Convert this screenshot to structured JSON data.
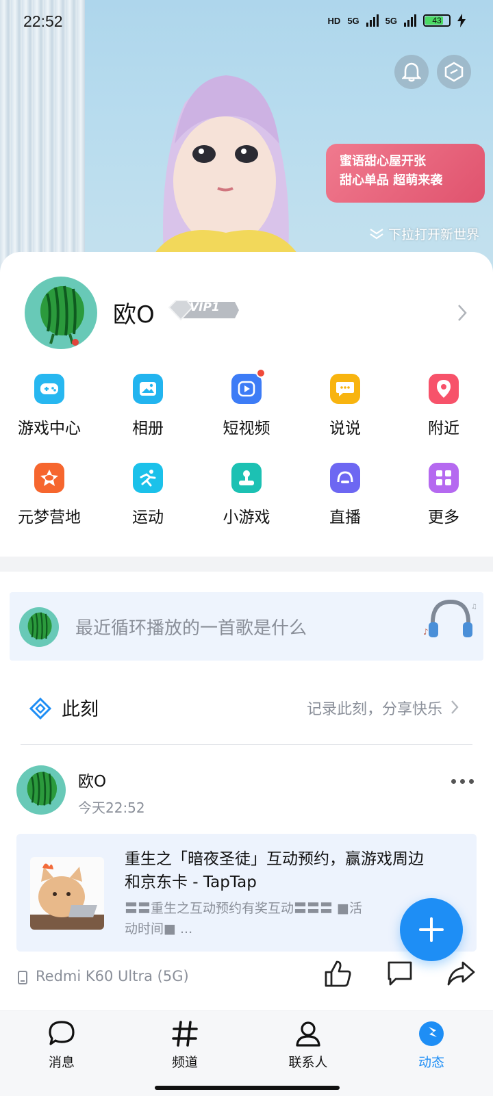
{
  "status_bar": {
    "time": "22:52",
    "hd_label": "HD",
    "network1": "5G",
    "network2": "5G",
    "battery_level": "43"
  },
  "banner": {
    "promo_line1": "蜜语甜心屋开张",
    "promo_line2": "甜心单品 超萌来袭",
    "pull_hint": "下拉打开新世界"
  },
  "profile": {
    "nickname": "欧O",
    "vip_label": "VIP1"
  },
  "grid": {
    "row1": [
      {
        "label": "游戏中心",
        "icon": "gamepad-icon",
        "color": "#27b7f0"
      },
      {
        "label": "相册",
        "icon": "photo-album-icon",
        "color": "#22b4ef"
      },
      {
        "label": "短视频",
        "icon": "short-video-icon",
        "color": "#3d7cf6",
        "badge": true
      },
      {
        "label": "说说",
        "icon": "chat-bubble-icon",
        "color": "#f8b40f"
      },
      {
        "label": "附近",
        "icon": "location-pin-icon",
        "color": "#f7526a"
      }
    ],
    "row2": [
      {
        "label": "元梦营地",
        "icon": "camp-icon",
        "color": "#f6662e"
      },
      {
        "label": "运动",
        "icon": "running-icon",
        "color": "#1bc1ea"
      },
      {
        "label": "小游戏",
        "icon": "joystick-icon",
        "color": "#1cc1b3"
      },
      {
        "label": "直播",
        "icon": "live-icon",
        "color": "#6d67f2"
      },
      {
        "label": "更多",
        "icon": "more-grid-icon",
        "color": "#b569f0"
      }
    ]
  },
  "prompt": {
    "text": "最近循环播放的一首歌是什么"
  },
  "moment": {
    "title": "此刻",
    "hint": "记录此刻，分享快乐"
  },
  "post": {
    "name": "欧O",
    "time": "今天22:52",
    "link_title": "重生之「暗夜圣徒」互动预约，赢游戏周边和京东卡 - TapTap",
    "link_desc": "〓〓重生之互动预约有奖互动〓〓〓 ■活动时间■ ...",
    "device": "Redmi K60 Ultra (5G)"
  },
  "tabs": [
    {
      "label": "消息",
      "icon": "message-bubble-icon"
    },
    {
      "label": "频道",
      "icon": "hashtag-icon"
    },
    {
      "label": "联系人",
      "icon": "contacts-person-icon"
    },
    {
      "label": "动态",
      "icon": "dynamic-compass-icon",
      "active": true
    }
  ],
  "colors": {
    "accent": "#1e8ef5",
    "active_tab": "#1e8ef5",
    "muted_text": "#8a8f99"
  }
}
